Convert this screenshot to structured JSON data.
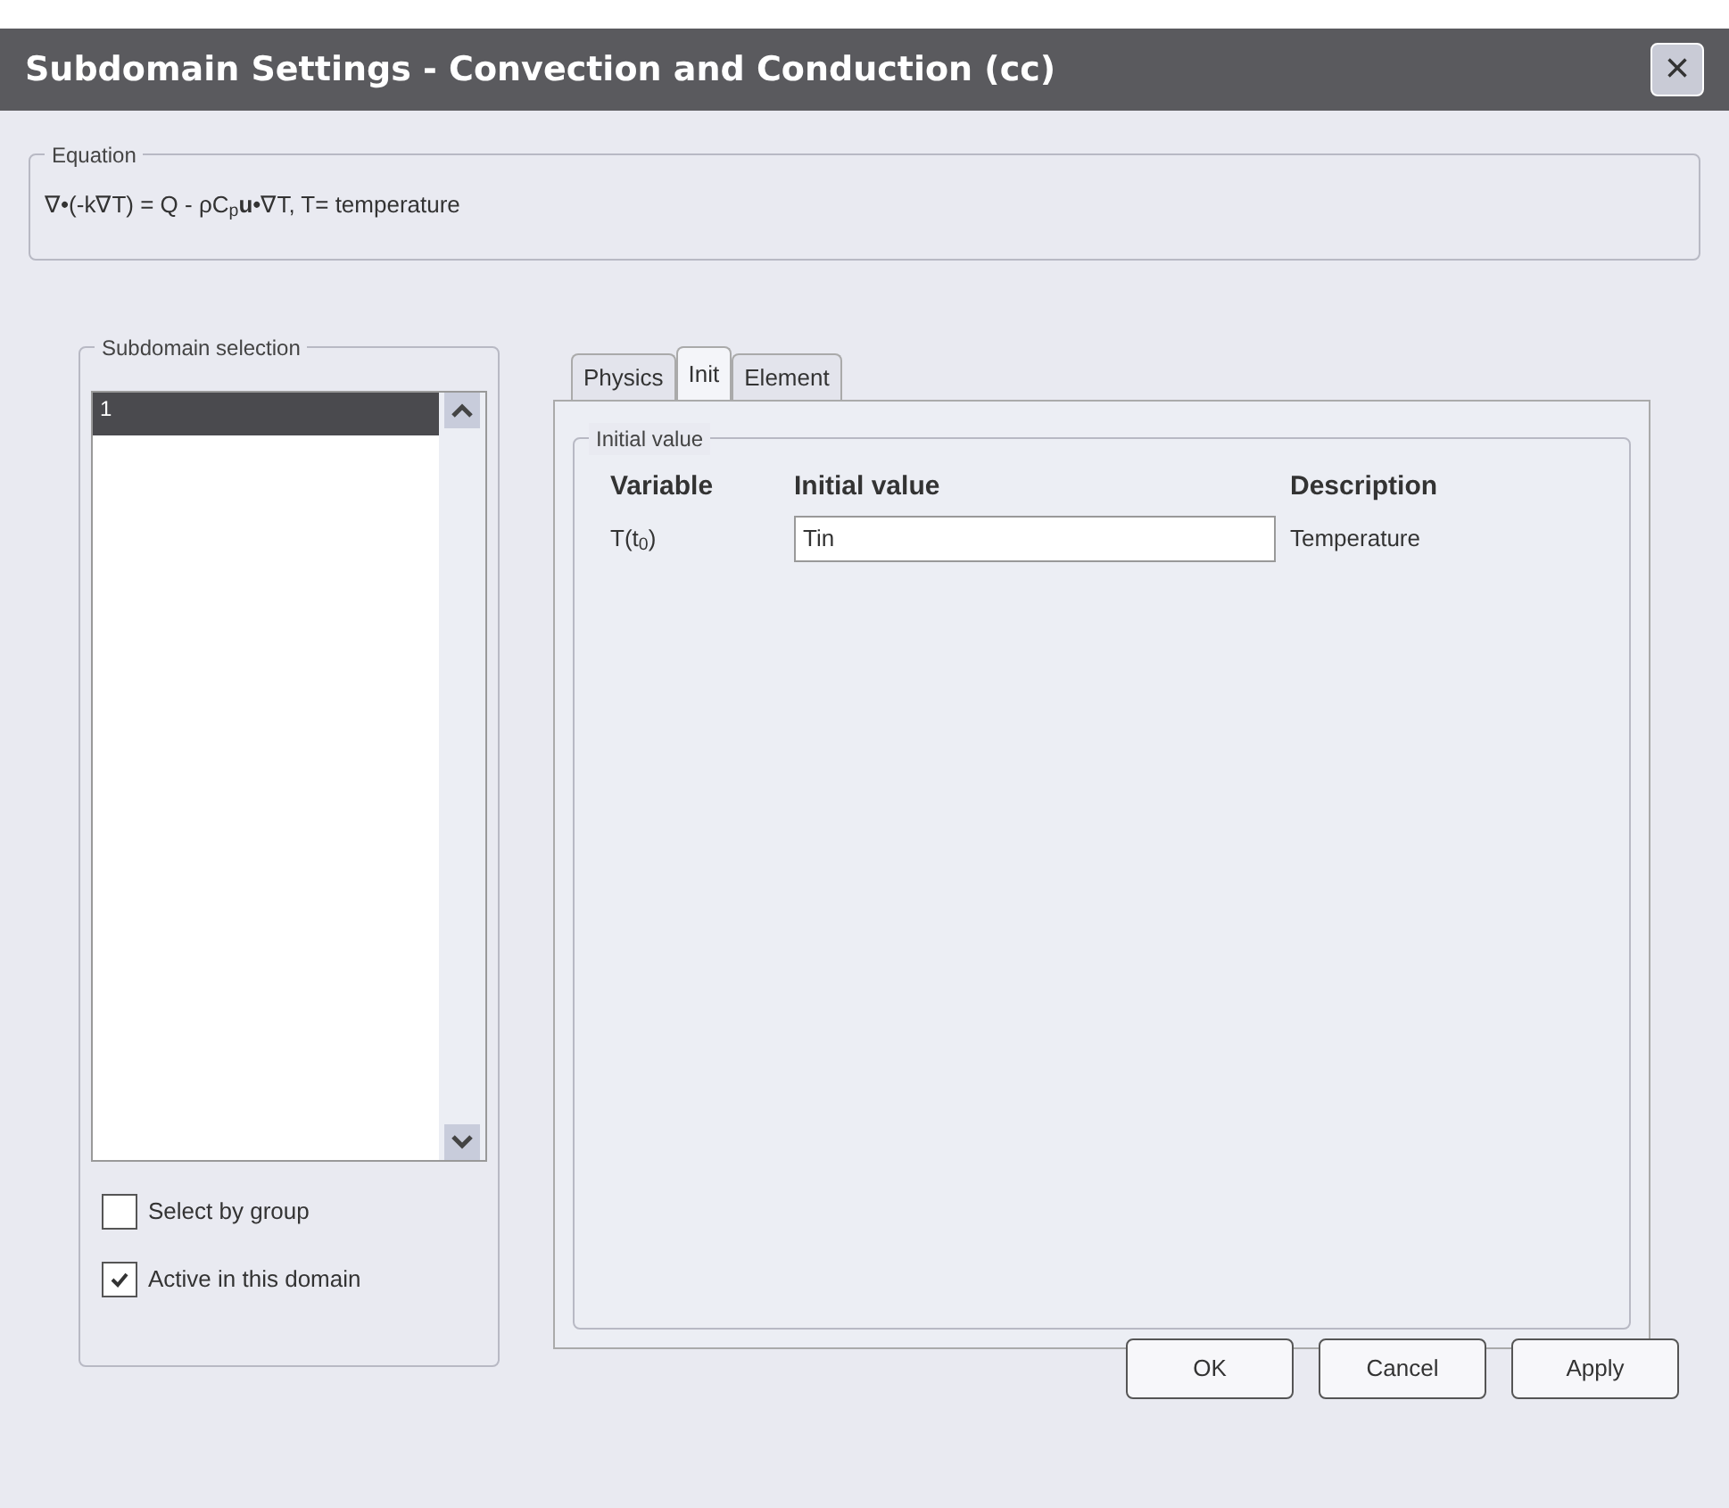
{
  "window": {
    "title": "Subdomain Settings - Convection and Conduction (cc)",
    "close": "×"
  },
  "equation": {
    "title": "Equation",
    "text": "∇•(-k∇T) = Q - ρC$_{p}$**u**•∇T, T= temperature"
  },
  "subdomain_selection": {
    "title": "Subdomain selection",
    "items": [
      {
        "label": "1",
        "selected": true
      }
    ],
    "checkboxes": [
      {
        "label": "Select by group",
        "checked": false
      },
      {
        "label": "Active in this domain",
        "checked": true
      }
    ]
  },
  "tabs": [
    {
      "label": "Physics",
      "selected": false
    },
    {
      "label": "Init",
      "selected": true
    },
    {
      "label": "Element",
      "selected": false
    }
  ],
  "initial_value": {
    "title": "Initial value",
    "columns": [
      "Variable",
      "Initial value",
      "Description"
    ],
    "rows": [
      {
        "variable": "T(t$_{0}$)",
        "value": "Tin",
        "description": "Temperature"
      }
    ]
  },
  "buttons": [
    "OK",
    "Cancel",
    "Apply"
  ]
}
